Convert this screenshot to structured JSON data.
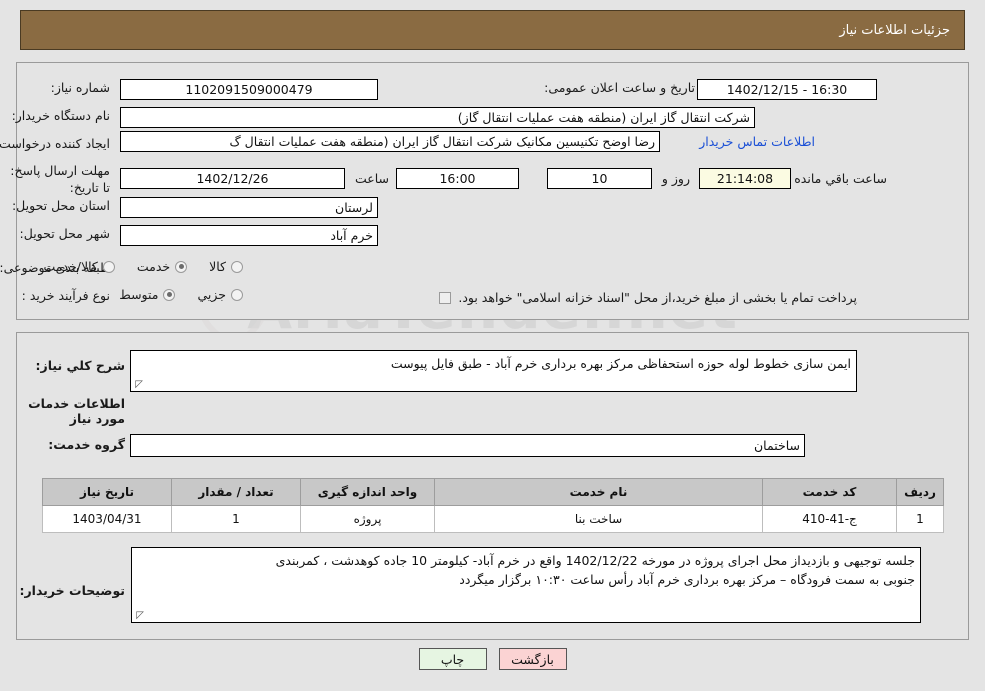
{
  "header": {
    "title": "جزئیات اطلاعات نیاز"
  },
  "form": {
    "need_number_label": "شماره نیاز:",
    "need_number_value": "1102091509000479",
    "announce_label": "تاریخ و ساعت اعلان عمومی:",
    "announce_value": "16:30 - 1402/12/15",
    "buyer_label": "نام دستگاه خریدار:",
    "buyer_value": "شرکت انتقال گاز ایران (منطقه هفت عملیات انتقال گاز)",
    "creator_label": "ایجاد کننده درخواست:",
    "creator_value": "رضا اوضح تکنیسین مکانیک شرکت انتقال گاز ایران (منطقه هفت عملیات انتقال گ",
    "contact_link": "اطلاعات تماس خریدار",
    "deadline_label": "مهلت ارسال پاسخ: تا تاریخ:",
    "deadline_date": "1402/12/26",
    "hour_label": "ساعت",
    "hour_value": "16:00",
    "days_value": "10",
    "days_label": "روز و",
    "countdown_value": "21:14:08",
    "countdown_label": "ساعت باقي مانده",
    "province_label": "استان محل تحویل:",
    "province_value": "لرستان",
    "city_label": "شهر محل تحویل:",
    "city_value": "خرم آباد",
    "category_label": "طبقه بندی موضوعی:",
    "category_options": [
      {
        "label": "کالا",
        "selected": false
      },
      {
        "label": "خدمت",
        "selected": true
      },
      {
        "label": "کالا/خدمت",
        "selected": false
      }
    ],
    "process_label": "نوع فرآیند خرید :",
    "process_options": [
      {
        "label": "جزیي",
        "selected": false
      },
      {
        "label": "متوسط",
        "selected": true
      }
    ],
    "treasury_note": "پرداخت تمام یا بخشی از مبلغ خرید،از محل \"اسناد خزانه اسلامی\" خواهد بود."
  },
  "need_summary": {
    "label": "شرح کلي نیاز:",
    "value": "ایمن سازی خطوط لوله حوزه استحفاظی مرکز بهره برداری خرم آباد - طبق فایل پیوست"
  },
  "services_section": {
    "heading": "اطلاعات خدمات مورد نیاز",
    "group_label": "گروه خدمت:",
    "group_value": "ساختمان"
  },
  "table": {
    "columns": [
      "ردیف",
      "کد خدمت",
      "نام خدمت",
      "واحد اندازه گیری",
      "تعداد / مقدار",
      "تاریخ نیاز"
    ],
    "rows": [
      {
        "index": "1",
        "code": "ج-41-410",
        "name": "ساخت بنا",
        "unit": "پروژه",
        "quantity": "1",
        "date": "1403/04/31"
      }
    ]
  },
  "buyer_notes": {
    "label": "توضیحات خریدار:",
    "line1": "جلسه توجیهی و بازدیداز محل اجرای پروژه در مورخه 1402/12/22 واقع در خرم آباد- کیلومتر 10 جاده کوهدشت ، کمربندی",
    "line2": "جنوبی به سمت فرودگاه – مرکز بهره برداری خرم آباد رأس ساعت ۱۰:۳۰ برگزار میگردد"
  },
  "footer": {
    "back_label": "بازگشت",
    "print_label": "چاپ"
  },
  "watermark": {
    "text": "AriaTender.net"
  },
  "colors": {
    "titlebar_bg": "#8a6b42",
    "link": "#1a4fd6",
    "countdown_bg": "#fbfbe2",
    "back_btn_bg": "#fbd3d3",
    "print_btn_bg": "#e6f5e2"
  }
}
